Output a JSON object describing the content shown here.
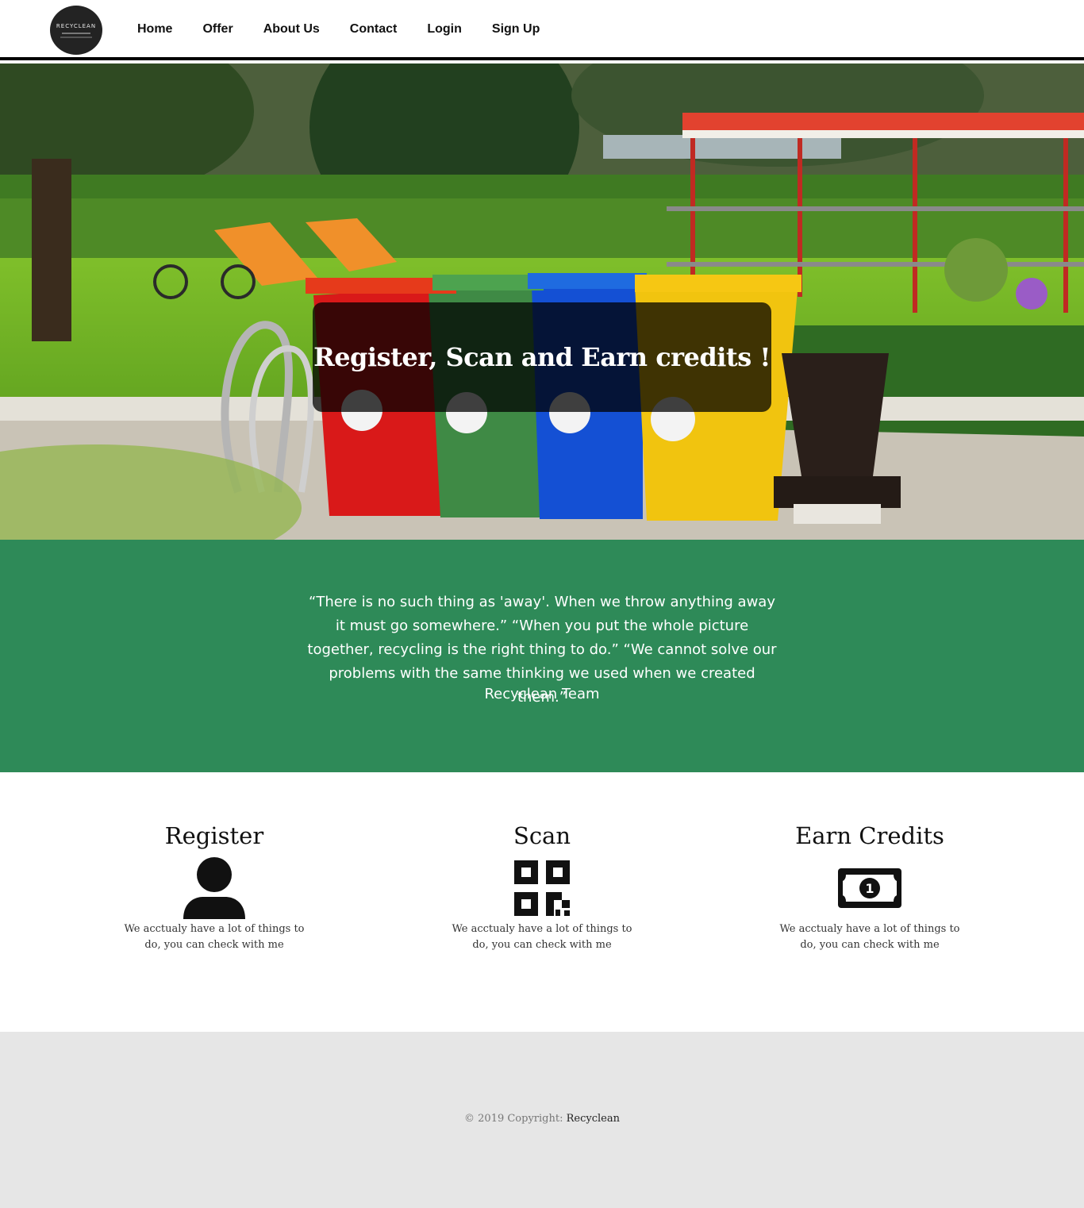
{
  "nav": {
    "logo_text": "RECYCLEAN",
    "links": [
      "Home",
      "Offer",
      "About Us",
      "Contact",
      "Login",
      "Sign Up"
    ]
  },
  "hero": {
    "title": "Register, Scan and Earn credits !"
  },
  "quote": {
    "text": "“There is no such thing as 'away'. When we throw anything away it must go somewhere.” “When you put the whole picture together, recycling is the right thing to do.” “We cannot solve our problems with the same thinking we used when we created them.”",
    "author": "Recyclean Team",
    "background_color": "#2e8a58"
  },
  "features": [
    {
      "title": "Register",
      "icon": "user-icon",
      "description": "We acctualy have a lot of things to do, you can check with me"
    },
    {
      "title": "Scan",
      "icon": "qr-code-icon",
      "description": "We acctualy have a lot of things to do, you can check with me"
    },
    {
      "title": "Earn Credits",
      "icon": "money-bill-icon",
      "description": "We acctualy have a lot of things to do, you can check with me"
    }
  ],
  "footer": {
    "copyright": "© 2019 Copyright: ",
    "brand": "Recyclean"
  }
}
